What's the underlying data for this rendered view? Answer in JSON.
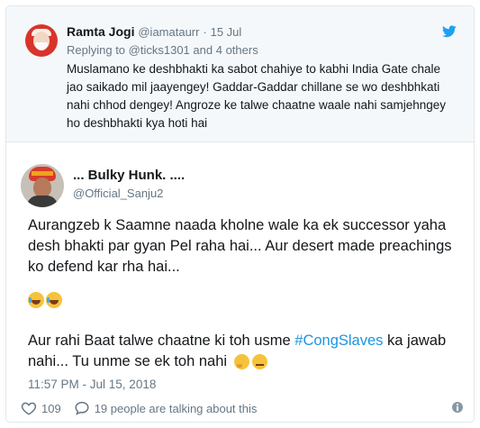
{
  "quoted_tweet": {
    "name": "Ramta Jogi",
    "handle": "@iamataurr",
    "dot": "·",
    "date": "15 Jul",
    "reply_prefix": "Replying to",
    "reply_user": "@ticks1301",
    "reply_suffix": "and 4 others",
    "text": "Muslamano ke deshbhakti ka sabot chahiye to kabhi India Gate chale jao saikado mil jaayengey! Gaddar-Gaddar chillane se wo deshbhkati nahi chhod dengey! Angroze ke talwe chaatne waale nahi samjehngey ho deshbhakti kya hoti hai"
  },
  "tweet": {
    "name": "... Bulky Hunk. ....",
    "handle": "@Official_Sanju2",
    "paragraph1": "Aurangzeb k Saamne naada kholne wale ka ek successor yaha desh bhakti par gyan Pel raha hai... Aur desert made preachings ko defend kar rha hai...",
    "line3_before": "Aur rahi Baat talwe chaatne ki toh usme",
    "hashtag": "#CongSlaves",
    "line3_after": "ka jawab nahi... Tu unme se ek toh nahi",
    "timestamp": "11:57 PM - Jul 15, 2018",
    "likes": "109",
    "talking": "19 people are talking about this"
  },
  "icons": {
    "twitter": "twitter-bird-icon",
    "like": "heart-icon",
    "reply": "speech-bubble-icon",
    "info": "info-icon"
  },
  "colors": {
    "accent": "#1da1f2",
    "hashtag": "#1b95e0",
    "muted": "#657786",
    "quoted_bg": "#f5f8fa",
    "border": "#e1e8ed"
  }
}
